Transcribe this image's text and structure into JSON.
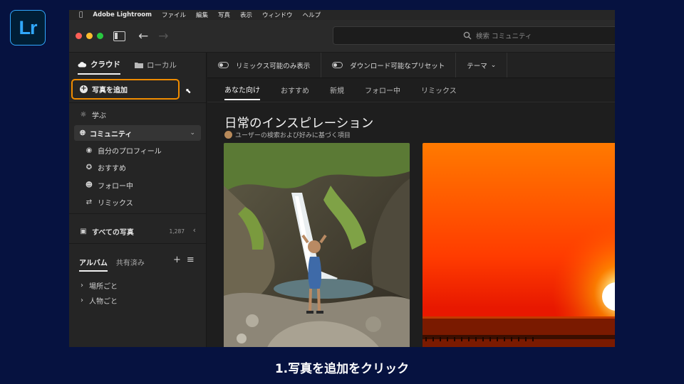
{
  "logo": {
    "text": "Lr",
    "brand_color": "#31a8ff"
  },
  "menubar": {
    "apple_icon": "apple-icon",
    "app_name": "Adobe Lightroom",
    "items": [
      "ファイル",
      "編集",
      "写真",
      "表示",
      "ウィンドウ",
      "ヘルプ"
    ]
  },
  "titlebar": {
    "traffic_lights": [
      "#ff5f57",
      "#febc2e",
      "#28c840"
    ],
    "search_placeholder": "検索 コミュニティ"
  },
  "sidebar": {
    "source_tabs": [
      {
        "label": "クラウド",
        "icon": "cloud-icon",
        "active": true
      },
      {
        "label": "ローカル",
        "icon": "folder-icon",
        "active": false
      }
    ],
    "add_photo_label": "写真を追加",
    "highlight_color": "#f08c00",
    "learn_label": "学ぶ",
    "community_label": "コミュニティ",
    "community_children": [
      {
        "label": "自分のプロフィール",
        "icon": "profile-icon"
      },
      {
        "label": "おすすめ",
        "icon": "award-icon"
      },
      {
        "label": "フォロー中",
        "icon": "following-icon"
      },
      {
        "label": "リミックス",
        "icon": "remix-icon"
      }
    ],
    "all_photos_label": "すべての写真",
    "all_photos_count": "1,287",
    "album_tabs": [
      {
        "label": "アルバム",
        "active": true
      },
      {
        "label": "共有済み",
        "active": false
      }
    ],
    "albums": [
      "場所ごと",
      "人物ごと"
    ]
  },
  "main": {
    "filters": [
      {
        "label": "リミックス可能のみ表示",
        "type": "toggle"
      },
      {
        "label": "ダウンロード可能なプリセット",
        "type": "toggle"
      },
      {
        "label": "テーマ",
        "type": "dropdown"
      }
    ],
    "subtabs": [
      {
        "label": "あなた向け",
        "active": true
      },
      {
        "label": "おすすめ",
        "active": false
      },
      {
        "label": "新規",
        "active": false
      },
      {
        "label": "フォロー中",
        "active": false
      },
      {
        "label": "リミックス",
        "active": false
      }
    ],
    "section_title": "日常のインスピレーション",
    "section_subtitle": "ユーザーの検索および好みに基づく項目"
  },
  "caption": "1.写真を追加をクリック"
}
